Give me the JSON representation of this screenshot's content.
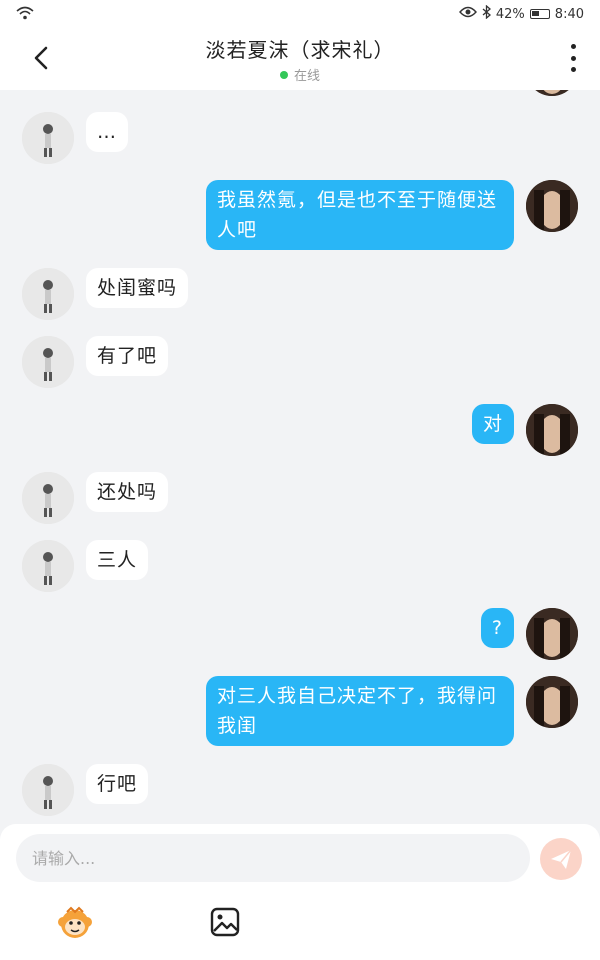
{
  "status_bar": {
    "battery": "42%",
    "time": "8:40"
  },
  "header": {
    "title": "淡若夏沫（求宋礼）",
    "status": "在线"
  },
  "messages": [
    {
      "from": "other",
      "text": "…"
    },
    {
      "from": "me",
      "text": "我虽然氪，但是也不至于随便送人吧"
    },
    {
      "from": "other",
      "text": "处闺蜜吗"
    },
    {
      "from": "other",
      "text": "有了吧"
    },
    {
      "from": "me",
      "text": "对"
    },
    {
      "from": "other",
      "text": "还处吗"
    },
    {
      "from": "other",
      "text": "三人"
    },
    {
      "from": "me",
      "text": "?"
    },
    {
      "from": "me",
      "text": "对三人我自己决定不了，我得问我闺"
    },
    {
      "from": "other",
      "text": "行吧"
    }
  ],
  "input": {
    "placeholder": "请输入..."
  },
  "icons": {
    "back": "chevron-left-icon",
    "more": "more-vertical-icon",
    "send": "send-icon",
    "emoji": "monkey-emoji-icon",
    "image": "image-icon",
    "wifi": "wifi-icon",
    "eye": "eye-icon",
    "bluetooth": "bluetooth-icon",
    "battery": "battery-icon"
  },
  "colors": {
    "my_bubble": "#29b6f6",
    "online_dot": "#34c759",
    "send_button": "#fbd4c8"
  }
}
